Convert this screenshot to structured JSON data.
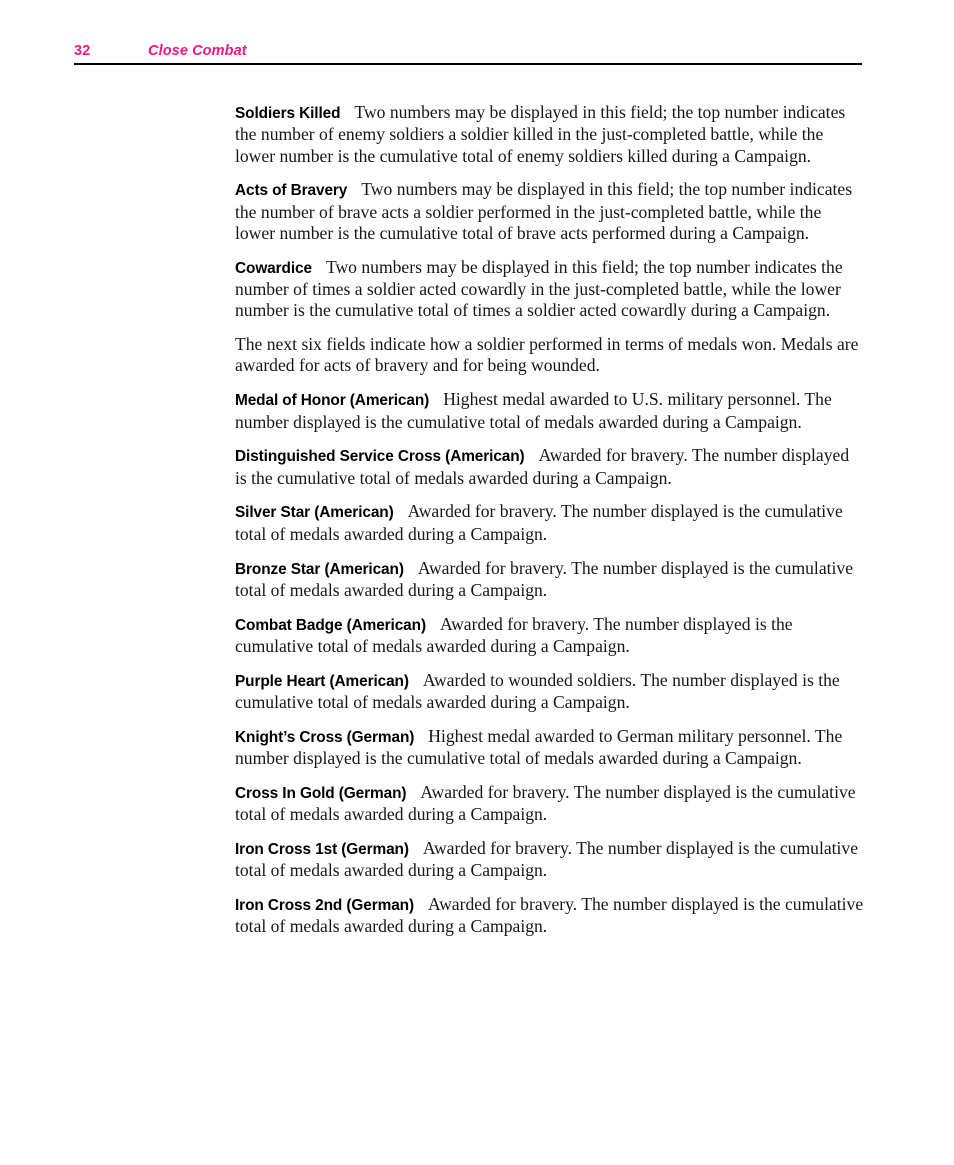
{
  "header": {
    "page_number": "32",
    "title": "Close Combat",
    "accent_color": "#ec1a84",
    "rule_color": "#000000"
  },
  "body": {
    "paragraphs": [
      {
        "term": "Soldiers Killed",
        "text": "Two numbers may be displayed in this field; the top number indicates the number of enemy soldiers a soldier killed in the just-completed battle, while the lower number is the cumulative total of enemy soldiers killed during a Campaign."
      },
      {
        "term": "Acts of Bravery",
        "text": "Two numbers may be displayed in this field; the top number indicates the number of brave acts a soldier performed in the just-completed battle, while the lower number is the cumulative total of brave acts performed during a Campaign."
      },
      {
        "term": "Cowardice",
        "text": "Two numbers may be displayed in this field; the top number indicates the number of times a soldier acted cowardly in the just-completed battle, while the lower number is the cumulative total of times a soldier acted cowardly during a Campaign."
      },
      {
        "term": "",
        "text": "The next six fields indicate how a soldier performed in terms of medals won. Medals are awarded for acts of bravery and for being wounded."
      },
      {
        "term": "Medal of Honor (American)",
        "text": "Highest medal awarded to U.S. military personnel. The number displayed is the cumulative total of medals awarded during a Campaign."
      },
      {
        "term": "Distinguished Service Cross (American)",
        "text": "Awarded for bravery. The number displayed is the cumulative total of medals awarded during a Campaign."
      },
      {
        "term": "Silver Star (American)",
        "text": "Awarded for bravery. The number displayed is the cumulative total of medals awarded during a Campaign."
      },
      {
        "term": "Bronze Star (American)",
        "text": "Awarded for bravery. The number displayed is the cumulative total of medals awarded during a Campaign."
      },
      {
        "term": "Combat Badge (American)",
        "text": "Awarded for bravery. The number displayed is the cumulative total of medals awarded during a Campaign."
      },
      {
        "term": "Purple Heart (American)",
        "text": "Awarded to wounded soldiers. The number displayed is the cumulative total of medals awarded during a Campaign."
      },
      {
        "term": "Knight’s Cross (German)",
        "text": "Highest medal awarded to German military personnel. The number displayed is the cumulative total of medals awarded during a Campaign."
      },
      {
        "term": "Cross In Gold (German)",
        "text": "Awarded for bravery. The number displayed is the cumulative total of medals awarded during a Campaign."
      },
      {
        "term": "Iron Cross 1st (German)",
        "text": "Awarded for bravery. The number displayed is the cumulative total of medals awarded during a Campaign."
      },
      {
        "term": "Iron Cross 2nd (German)",
        "text": "Awarded for bravery. The number displayed is the cumulative total of medals awarded during a Campaign."
      }
    ]
  }
}
